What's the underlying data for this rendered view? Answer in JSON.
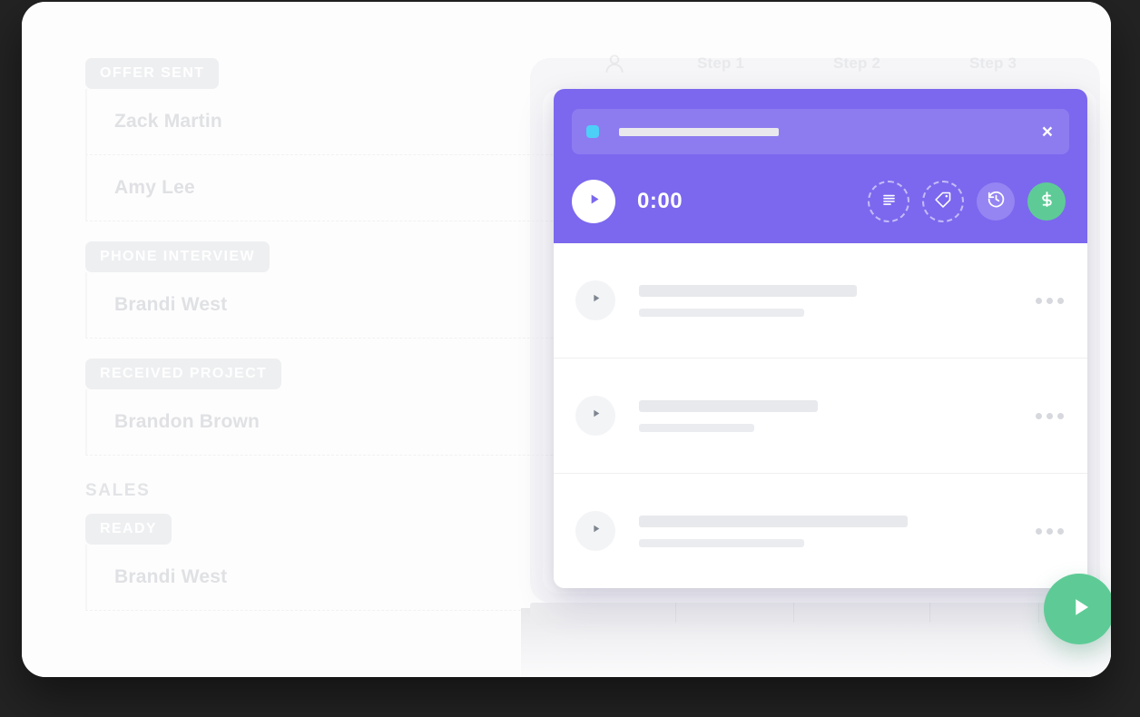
{
  "colors": {
    "purple": "#7B68EE",
    "purple_light": "#8D7CF0",
    "purple_solid_button": "#9585F2",
    "cyan": "#4DD0F7",
    "green": "#5ECB96",
    "page_bg": "#232323",
    "card_bg": "#FFFFFF",
    "placeholder_gray": "#E8E9EC"
  },
  "background_app": {
    "steps": {
      "person_icon": "person-icon",
      "labels": [
        "Step 1",
        "Step 2",
        "Step 3"
      ]
    },
    "groups": [
      {
        "title": null,
        "stages": [
          {
            "chip": "OFFER SENT",
            "rows": [
              "Zack Martin",
              "Amy Lee"
            ]
          },
          {
            "chip": "PHONE INTERVIEW",
            "rows": [
              "Brandi West"
            ]
          },
          {
            "chip": "RECEIVED PROJECT",
            "rows": [
              "Brandon Brown"
            ]
          }
        ]
      },
      {
        "title": "SALES",
        "stages": [
          {
            "chip": "READY",
            "rows": [
              "Brandi West"
            ]
          }
        ]
      }
    ]
  },
  "modal": {
    "header": {
      "search": {
        "dot_icon": "status-dot-icon",
        "value": "",
        "placeholder": ""
      },
      "close_label": "×",
      "player": {
        "play_icon": "play-icon",
        "time": "0:00"
      },
      "actions": [
        {
          "name": "notes",
          "icon": "notes-icon",
          "style": "dashed"
        },
        {
          "name": "tag",
          "icon": "tag-icon",
          "style": "dashed"
        },
        {
          "name": "history",
          "icon": "history-icon",
          "style": "solid"
        },
        {
          "name": "billing",
          "icon": "dollar-icon",
          "style": "green"
        }
      ]
    },
    "items": [
      {
        "play_icon": "play-icon",
        "title_width": 240,
        "sub_width": 182,
        "menu_icon": "more-options-icon"
      },
      {
        "play_icon": "play-icon",
        "title_width": 197,
        "sub_width": 127,
        "menu_icon": "more-options-icon"
      },
      {
        "play_icon": "play-icon",
        "title_width": 296,
        "sub_width": 182,
        "menu_icon": "more-options-icon"
      }
    ]
  },
  "fab": {
    "icon": "play-icon",
    "label": ""
  }
}
